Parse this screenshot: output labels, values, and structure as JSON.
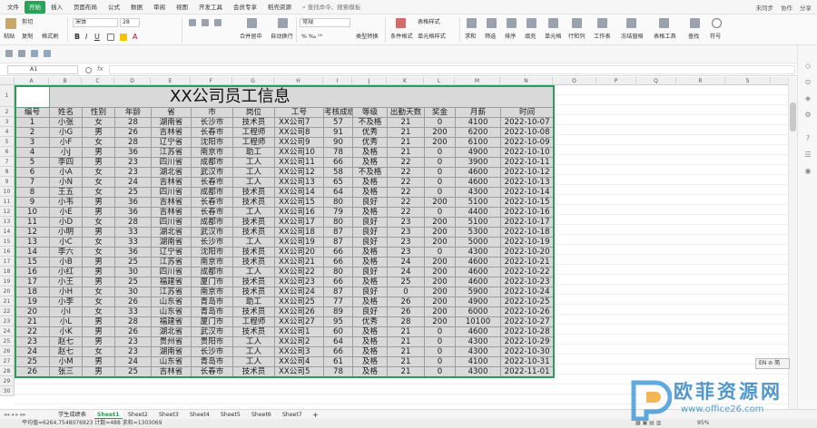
{
  "menubar": {
    "items": [
      "文件",
      "开始",
      "插入",
      "页面布局",
      "公式",
      "数据",
      "审阅",
      "视图",
      "开发工具",
      "会员专享",
      "稻壳资源"
    ],
    "search_label": "查找命令、搜索模板",
    "right": [
      "未同步",
      "协作",
      "分享"
    ],
    "active_color": "#29a35a"
  },
  "ribbon": {
    "row1": [
      "剪切",
      "宋体",
      "28",
      "常规",
      "表格样式",
      "求和",
      "筛选",
      "排序",
      "格式",
      "行和列",
      "工作表",
      "冻结窗格",
      "表格工具",
      "查找",
      "符号"
    ],
    "row1b": [
      "粘贴",
      "复制",
      "格式刷",
      "合并居中",
      "自动换行",
      "类型转换",
      "条件格式",
      "单元格样式",
      "填充",
      "单元格"
    ],
    "font_name": "宋体",
    "font_size": "28",
    "number_format": "常规"
  },
  "formula_bar": {
    "name_box": "A1",
    "fx": "fx",
    "value": ""
  },
  "columns": [
    "A",
    "B",
    "C",
    "D",
    "E",
    "F",
    "G",
    "H",
    "I",
    "J",
    "K",
    "L",
    "M",
    "N",
    "O",
    "P",
    "Q",
    "R",
    "S",
    "T",
    "U",
    "V"
  ],
  "spreadsheet": {
    "title": "XX公司员工信息",
    "headers": [
      "编号",
      "姓名",
      "性别",
      "年龄",
      "省",
      "市",
      "岗位",
      "工号",
      "考核成绩",
      "等级",
      "出勤天数",
      "奖金",
      "月薪",
      "时间"
    ],
    "rows": [
      [
        "1",
        "小张",
        "女",
        "28",
        "湖南省",
        "长沙市",
        "技术员",
        "XX公司7",
        "57",
        "不及格",
        "21",
        "0",
        "4100",
        "2022-10-07"
      ],
      [
        "2",
        "小G",
        "男",
        "26",
        "吉林省",
        "长春市",
        "工程师",
        "XX公司8",
        "91",
        "优秀",
        "21",
        "200",
        "6200",
        "2022-10-08"
      ],
      [
        "3",
        "小F",
        "女",
        "28",
        "辽宁省",
        "沈阳市",
        "工程师",
        "XX公司9",
        "90",
        "优秀",
        "21",
        "200",
        "6100",
        "2022-10-09"
      ],
      [
        "4",
        "小J",
        "男",
        "36",
        "江苏省",
        "南京市",
        "助工",
        "XX公司10",
        "78",
        "及格",
        "21",
        "0",
        "4900",
        "2022-10-10"
      ],
      [
        "5",
        "李四",
        "男",
        "23",
        "四川省",
        "成都市",
        "工人",
        "XX公司11",
        "66",
        "及格",
        "22",
        "0",
        "3900",
        "2022-10-11"
      ],
      [
        "6",
        "小A",
        "女",
        "23",
        "湖北省",
        "武汉市",
        "工人",
        "XX公司12",
        "58",
        "不及格",
        "22",
        "0",
        "4600",
        "2022-10-12"
      ],
      [
        "7",
        "小N",
        "女",
        "24",
        "吉林省",
        "长春市",
        "工人",
        "XX公司13",
        "65",
        "及格",
        "22",
        "0",
        "4600",
        "2022-10-13"
      ],
      [
        "8",
        "王五",
        "女",
        "25",
        "四川省",
        "成都市",
        "技术员",
        "XX公司14",
        "64",
        "及格",
        "22",
        "0",
        "4300",
        "2022-10-14"
      ],
      [
        "9",
        "小韦",
        "男",
        "36",
        "吉林省",
        "长春市",
        "技术员",
        "XX公司15",
        "80",
        "良好",
        "22",
        "200",
        "5100",
        "2022-10-15"
      ],
      [
        "10",
        "小E",
        "男",
        "36",
        "吉林省",
        "长春市",
        "工人",
        "XX公司16",
        "79",
        "及格",
        "22",
        "0",
        "4400",
        "2022-10-16"
      ],
      [
        "11",
        "小D",
        "女",
        "28",
        "四川省",
        "成都市",
        "技术员",
        "XX公司17",
        "80",
        "良好",
        "23",
        "200",
        "5100",
        "2022-10-17"
      ],
      [
        "12",
        "小明",
        "男",
        "33",
        "湖北省",
        "武汉市",
        "技术员",
        "XX公司18",
        "87",
        "良好",
        "23",
        "200",
        "5300",
        "2022-10-18"
      ],
      [
        "13",
        "小C",
        "女",
        "33",
        "湖南省",
        "长沙市",
        "工人",
        "XX公司19",
        "87",
        "良好",
        "23",
        "200",
        "5000",
        "2022-10-19"
      ],
      [
        "14",
        "李六",
        "女",
        "36",
        "辽宁省",
        "沈阳市",
        "技术员",
        "XX公司20",
        "66",
        "及格",
        "23",
        "0",
        "4300",
        "2022-10-20"
      ],
      [
        "15",
        "小B",
        "男",
        "25",
        "江苏省",
        "南京市",
        "技术员",
        "XX公司21",
        "66",
        "及格",
        "24",
        "200",
        "4600",
        "2022-10-21"
      ],
      [
        "16",
        "小红",
        "男",
        "30",
        "四川省",
        "成都市",
        "工人",
        "XX公司22",
        "80",
        "良好",
        "24",
        "200",
        "4600",
        "2022-10-22"
      ],
      [
        "17",
        "小王",
        "男",
        "25",
        "福建省",
        "厦门市",
        "技术员",
        "XX公司23",
        "66",
        "及格",
        "25",
        "200",
        "4600",
        "2022-10-23"
      ],
      [
        "18",
        "小H",
        "女",
        "30",
        "江苏省",
        "南京市",
        "技术员",
        "XX公司24",
        "87",
        "良好",
        "0",
        "200",
        "5900",
        "2022-10-24"
      ],
      [
        "19",
        "小李",
        "女",
        "26",
        "山东省",
        "青岛市",
        "助工",
        "XX公司25",
        "77",
        "及格",
        "26",
        "200",
        "4900",
        "2022-10-25"
      ],
      [
        "20",
        "小I",
        "女",
        "33",
        "山东省",
        "青岛市",
        "技术员",
        "XX公司26",
        "89",
        "良好",
        "26",
        "200",
        "6000",
        "2022-10-26"
      ],
      [
        "21",
        "小L",
        "男",
        "28",
        "福建省",
        "厦门市",
        "工程师",
        "XX公司27",
        "95",
        "优秀",
        "28",
        "200",
        "10100",
        "2022-10-27"
      ],
      [
        "22",
        "小K",
        "男",
        "26",
        "湖北省",
        "武汉市",
        "技术员",
        "XX公司1",
        "60",
        "及格",
        "21",
        "0",
        "4600",
        "2022-10-28"
      ],
      [
        "23",
        "赵七",
        "男",
        "23",
        "贵州省",
        "贵阳市",
        "工人",
        "XX公司2",
        "64",
        "及格",
        "21",
        "0",
        "4300",
        "2022-10-29"
      ],
      [
        "24",
        "赵七",
        "女",
        "23",
        "湖南省",
        "长沙市",
        "工人",
        "XX公司3",
        "66",
        "及格",
        "21",
        "0",
        "4300",
        "2022-10-30"
      ],
      [
        "25",
        "小M",
        "男",
        "24",
        "山东省",
        "青岛市",
        "工人",
        "XX公司4",
        "61",
        "及格",
        "21",
        "0",
        "4100",
        "2022-10-31"
      ],
      [
        "26",
        "张三",
        "男",
        "25",
        "吉林省",
        "长春市",
        "技术员",
        "XX公司5",
        "78",
        "及格",
        "21",
        "0",
        "4300",
        "2022-11-01"
      ]
    ]
  },
  "extra_rows": [
    "29",
    "30"
  ],
  "sheet_tabs": [
    "学生成绩表",
    "Sheet1",
    "Sheet2",
    "Sheet3",
    "Sheet4",
    "Sheet5",
    "Sheet6",
    "Sheet7"
  ],
  "active_tab": "Sheet1",
  "add_tab": "+",
  "status": {
    "left": "平均值=6264.7548076923  计数=488  求和=1303069",
    "zoom": "95%",
    "tooltip": "EN ⊘ 简"
  },
  "watermark": {
    "title": "欧菲资源网",
    "url": "www.office26.com"
  }
}
